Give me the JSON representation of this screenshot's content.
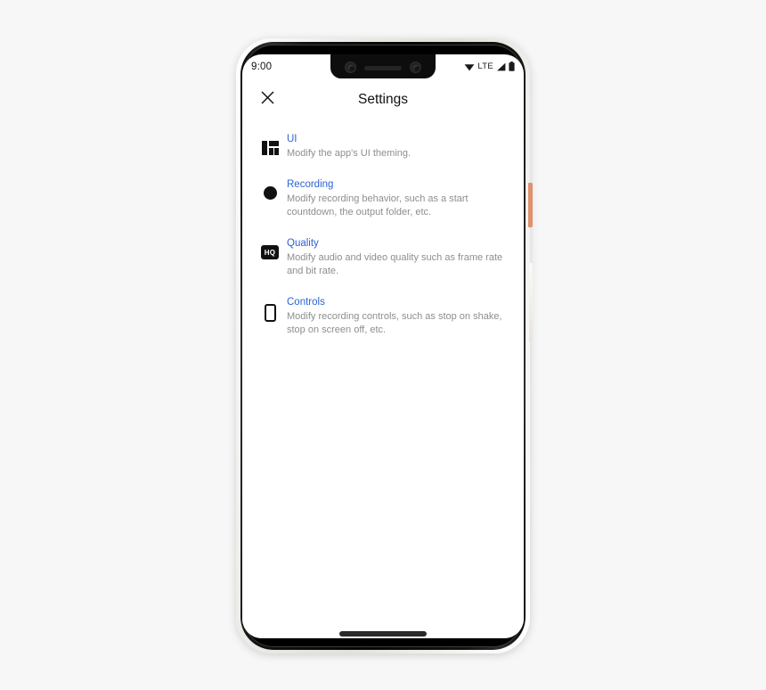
{
  "device": {
    "type": "smartphone-mockup",
    "frame_color": "#141414",
    "bezel_color": "#ece9e4",
    "power_button_color": "#e0906e",
    "volume_button_color": "#f5f2ee"
  },
  "status_bar": {
    "time": "9:00",
    "network_label": "LTE",
    "icons": [
      "wifi-icon",
      "signal-icon",
      "battery-icon"
    ]
  },
  "app_bar": {
    "close_icon": "close-icon",
    "title": "Settings"
  },
  "settings": {
    "accent_color": "#2e63d6",
    "description_color": "#8e8e8e",
    "items": [
      {
        "icon": "dashboard-layout-icon",
        "title": "UI",
        "description": "Modify the app's UI theming."
      },
      {
        "icon": "record-circle-icon",
        "title": "Recording",
        "description": "Modify recording behavior, such as a start countdown, the output folder, etc."
      },
      {
        "icon": "hq-badge-icon",
        "title": "Quality",
        "description": "Modify audio and video quality such as frame rate and bit rate."
      },
      {
        "icon": "phone-outline-icon",
        "title": "Controls",
        "description": "Modify recording controls, such as stop on shake, stop on screen off, etc."
      }
    ]
  }
}
